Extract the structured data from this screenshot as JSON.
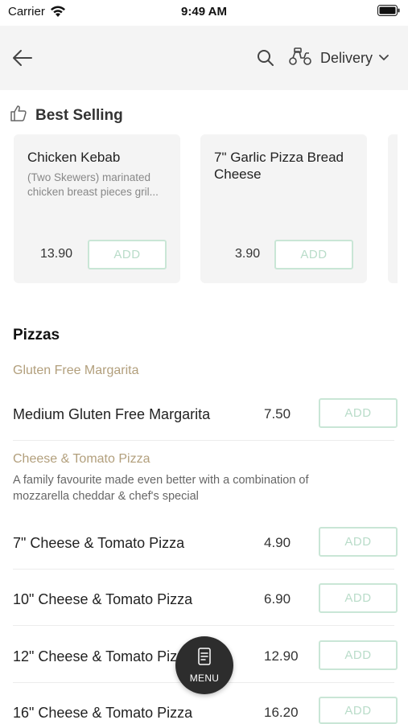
{
  "status_bar": {
    "carrier": "Carrier",
    "time": "9:49 AM"
  },
  "header": {
    "delivery_label": "Delivery"
  },
  "best_selling": {
    "title": "Best Selling",
    "items": [
      {
        "name": "Chicken Kebab",
        "description": "(Two Skewers) marinated chicken breast pieces gril...",
        "price": "13.90",
        "add_label": "ADD"
      },
      {
        "name": "7\" Garlic Pizza Bread Cheese",
        "description": "",
        "price": "3.90",
        "add_label": "ADD"
      }
    ]
  },
  "pizzas": {
    "title": "Pizzas",
    "subcategories": [
      {
        "name": "Gluten Free Margarita",
        "description": "",
        "items": [
          {
            "name": "Medium Gluten Free Margarita",
            "price": "7.50",
            "add_label": "ADD"
          }
        ]
      },
      {
        "name": "Cheese & Tomato Pizza",
        "description": "A family favourite made even better with a combination of mozzarella cheddar & chef's special",
        "items": [
          {
            "name": "7\" Cheese & Tomato Pizza",
            "price": "4.90",
            "add_label": "ADD"
          },
          {
            "name": "10\" Cheese & Tomato Pizza",
            "price": "6.90",
            "add_label": "ADD"
          },
          {
            "name": "12\" Cheese & Tomato Pizza",
            "price": "12.90",
            "add_label": "ADD"
          },
          {
            "name": "16\" Cheese & Tomato Pizza",
            "price": "16.20",
            "add_label": "ADD"
          }
        ]
      }
    ]
  },
  "menu_button": {
    "label": "MENU"
  },
  "colors": {
    "header_bg": "#f4f4f4",
    "card_bg": "#f4f4f4",
    "add_border": "#c9e6d6",
    "subcategory": "#b29f7c",
    "fab": "#2d2d2d"
  }
}
